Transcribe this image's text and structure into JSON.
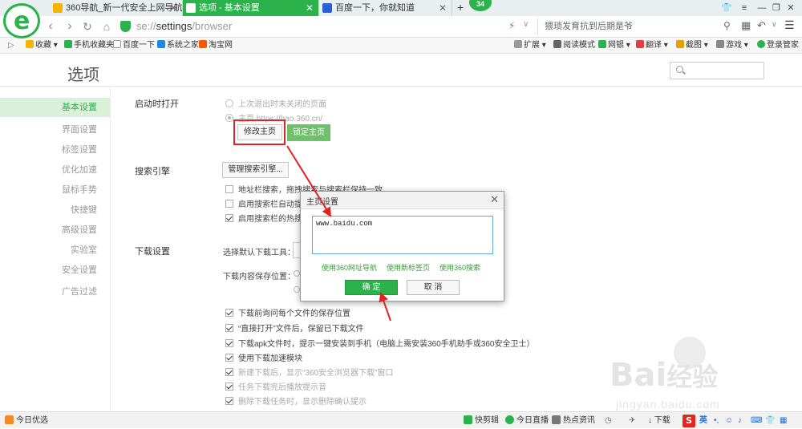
{
  "browser": {
    "tabs": [
      {
        "label": "360导航_新一代安全上网导航",
        "active": false
      },
      {
        "label": "选项 - 基本设置",
        "active": true
      },
      {
        "label": "百度一下，你就知道",
        "active": false
      }
    ],
    "new_tab": "+",
    "badge_count": "34",
    "url_prefix": "se://",
    "url_main": "settings",
    "url_suffix": "/browser",
    "news_text": "猥琐发育抗到后期是爷",
    "bookmarks": [
      "收藏",
      "手机收藏夹",
      "百度一下",
      "系统之家",
      "淘宝网"
    ],
    "toolbar_right": [
      "扩展",
      "阅读模式",
      "网银",
      "翻译",
      "截图",
      "游戏",
      "登录管家"
    ]
  },
  "settings": {
    "title": "选项",
    "search_placeholder": "",
    "nav": [
      "基本设置",
      "界面设置",
      "标签设置",
      "优化加速",
      "鼠标手势",
      "快捷键",
      "高级设置",
      "实验室",
      "安全设置",
      "广告过滤"
    ],
    "startup": {
      "label": "启动时打开",
      "option1": "上次退出时未关闭的页面",
      "option2": "主页 https://hao.360.cn/",
      "modify_btn": "修改主页",
      "lock_btn": "锁定主页"
    },
    "search": {
      "label": "搜索引擎",
      "manage_btn": "管理搜索引擎...",
      "opt1": "地址栏搜索，拖拽搜索与搜索栏保持一致",
      "opt2": "启用搜索栏自动提",
      "opt3": "启用搜索栏的热搜"
    },
    "download": {
      "label": "下载设置",
      "tool_label": "选择默认下载工具：",
      "path_label": "下载内容保存位置：",
      "items": [
        "下载前询问每个文件的保存位置",
        "“直接打开”文件后，保留已下载文件",
        "下载apk文件时，提示一键安装到手机（电脑上需安装360手机助手或360安全卫士）",
        "使用下载加速模块",
        "新建下载后，显示“360安全浏览器下载”窗口",
        "任务下载完后播放提示音",
        "删除下载任务时，显示删除确认提示"
      ]
    }
  },
  "dialog": {
    "title": "主页设置",
    "value": "www.baidu.com",
    "links": [
      "使用360网址导航",
      "使用新标签页",
      "使用360搜索"
    ],
    "ok": "确 定",
    "cancel": "取 消"
  },
  "watermark": {
    "brand": "Bai",
    "brand2": "经验",
    "site": "jingyan.baidu.com"
  },
  "statusbar": {
    "left": "今日优选",
    "items": [
      "快剪辑",
      "今日直播",
      "热点资讯",
      "下载"
    ],
    "ime": "英"
  },
  "colors": {
    "accent": "#2cb24a",
    "annotation": "#e02424"
  }
}
